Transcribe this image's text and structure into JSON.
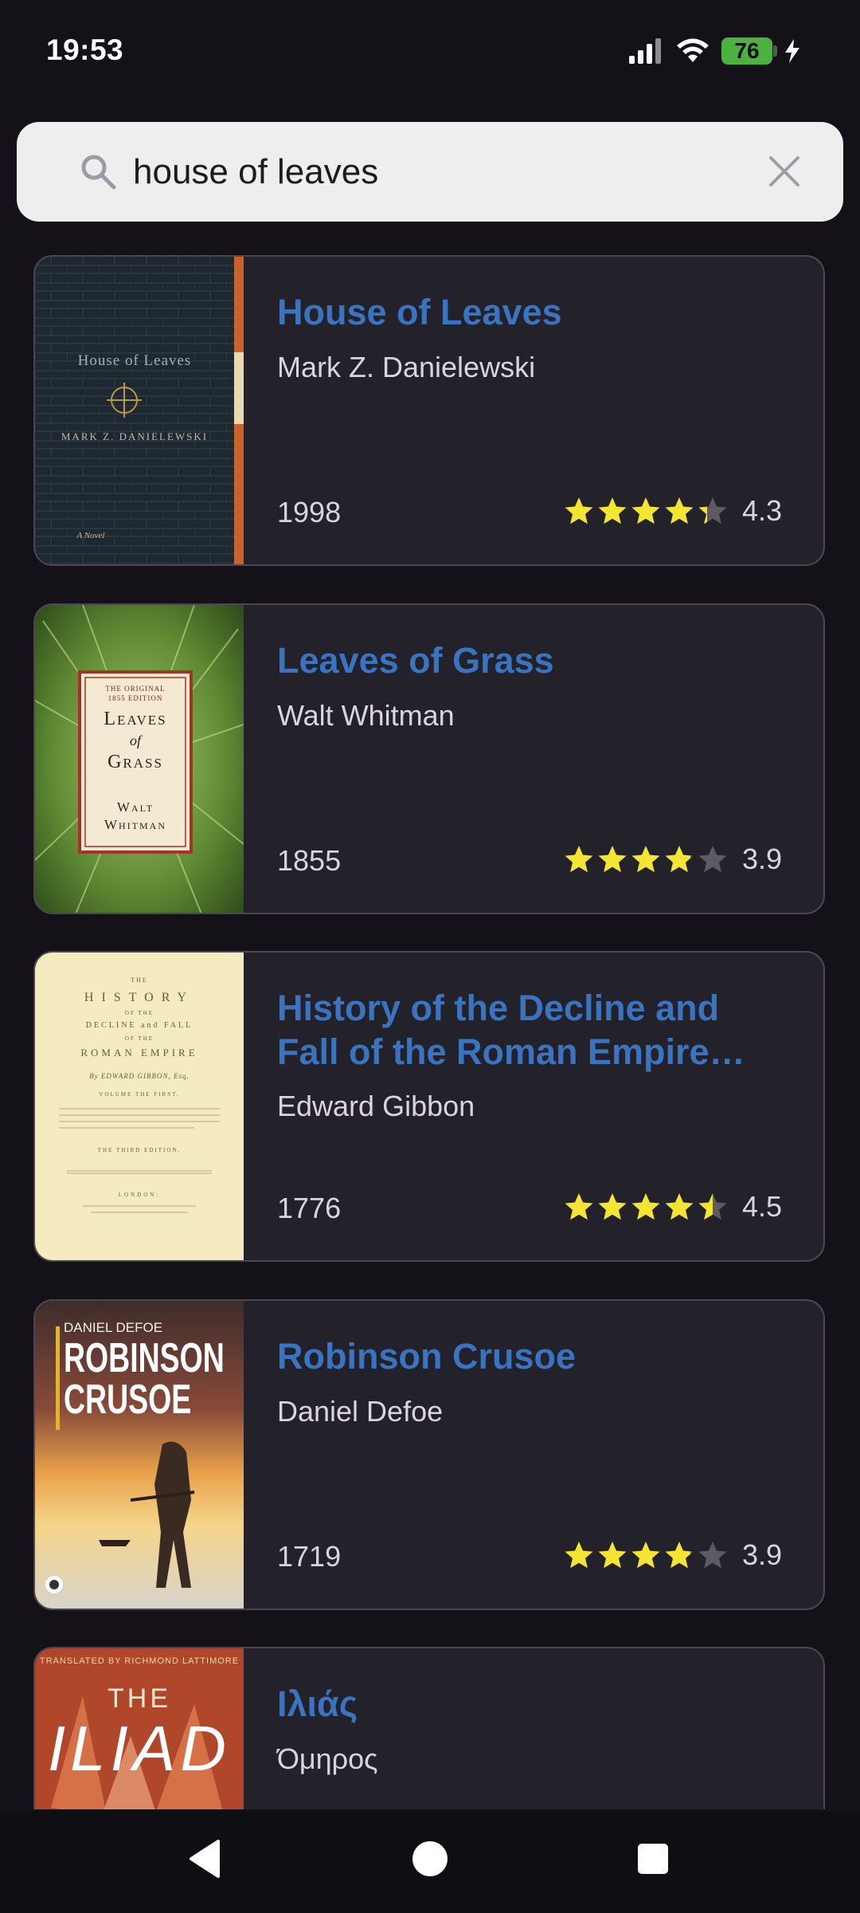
{
  "status": {
    "time": "19:53",
    "battery": "76"
  },
  "search": {
    "query": "house of leaves"
  },
  "results": [
    {
      "title": "House of Leaves",
      "author": "Mark Z. Danielewski",
      "year": "1998",
      "rating": "4.3",
      "rating_value": 4.3,
      "cover": {
        "line1": "House of Leaves",
        "line2": "Mark Z. Danielewski",
        "line3": "A Novel"
      }
    },
    {
      "title": "Leaves of Grass",
      "author": "Walt Whitman",
      "year": "1855",
      "rating": "3.9",
      "rating_value": 3.9,
      "cover": {
        "line1": "THE ORIGINAL",
        "line2": "1855 EDITION",
        "line3": "Leaves",
        "line4": "of",
        "line5": "Grass",
        "line6": "Walt",
        "line7": "Whitman"
      }
    },
    {
      "title": "History of the Decline and Fall of the Roman Empire Co…",
      "author": "Edward Gibbon",
      "year": "1776",
      "rating": "4.5",
      "rating_value": 4.5,
      "cover": {
        "line1": "THE",
        "line2": "HISTORY",
        "line3": "OF THE",
        "line4": "DECLINE and FALL",
        "line5": "OF THE",
        "line6": "ROMAN EMPIRE",
        "line7": "By EDWARD GIBBON, Esq.",
        "line8": "VOLUME THE FIRST.",
        "line9": "THE THIRD EDITION.",
        "line10": "LONDON:"
      }
    },
    {
      "title": "Robinson Crusoe",
      "author": "Daniel Defoe",
      "year": "1719",
      "rating": "3.9",
      "rating_value": 3.9,
      "cover": {
        "line1": "DANIEL DEFOE",
        "line2": "ROBINSON",
        "line3": "CRUSOE"
      }
    },
    {
      "title": "Ιλιάς",
      "author": "Όμηρος",
      "year": "",
      "rating": "",
      "rating_value": null,
      "cover": {
        "line1": "TRANSLATED BY RICHMOND LATTIMORE",
        "line2": "THE",
        "line3": "ILIAD"
      }
    }
  ],
  "colors": {
    "title": "#3a74c1",
    "star": "#f5e533",
    "star_empty": "#5d5a63",
    "card": "#232129",
    "background": "#141218"
  },
  "icons": {
    "search": "search-icon",
    "clear": "close-icon",
    "back": "back-triangle-icon",
    "home": "home-circle-icon",
    "recents": "recents-square-icon"
  }
}
